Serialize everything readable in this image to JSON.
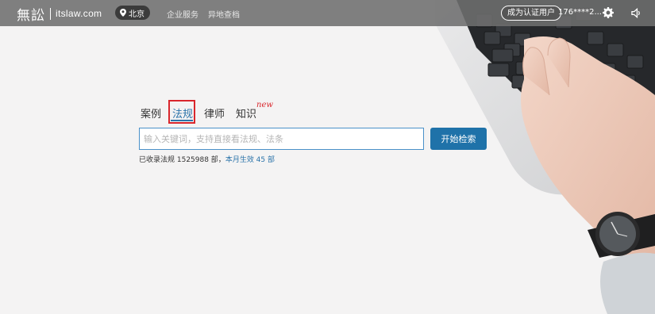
{
  "header": {
    "logo_cn": "無訟",
    "logo_en": "itslaw.com",
    "city": "北京",
    "nav": [
      "企业服务",
      "异地查档"
    ],
    "user_badge": "成为认证用户",
    "user_phone": "176****2..."
  },
  "search": {
    "tabs": [
      {
        "label": "案例"
      },
      {
        "label": "法规"
      },
      {
        "label": "律师"
      },
      {
        "label": "知识"
      }
    ],
    "active_tab": "法规",
    "new_badge": "new",
    "placeholder": "输入关键词，支持直接看法规、法条",
    "button_label": "开始检索",
    "stats_prefix": "已收录法规 1525988 部，",
    "stats_link": "本月生效 45 部"
  },
  "colors": {
    "accent": "#1f72a9",
    "highlight_box": "#d9262c",
    "topbar": "#6e6e6e"
  },
  "icons": [
    "location-pin-icon",
    "gear-icon",
    "speaker-icon"
  ]
}
